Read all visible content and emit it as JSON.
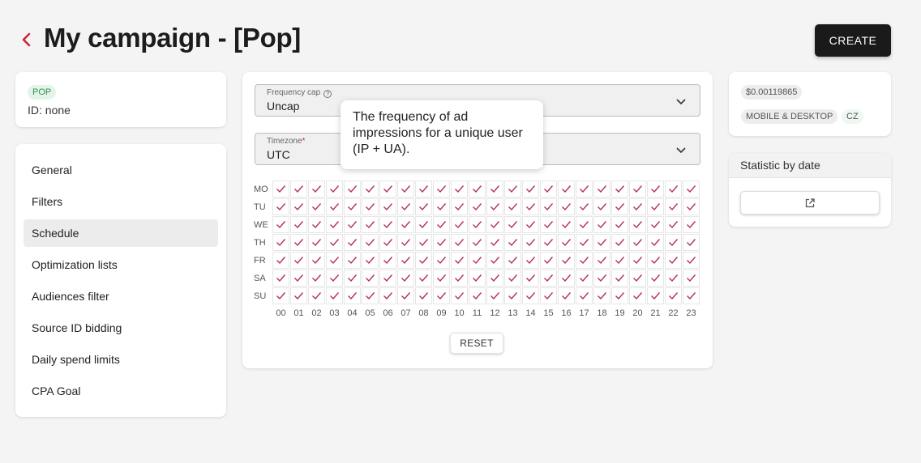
{
  "header": {
    "title": "My campaign - [Pop]",
    "create_label": "CREATE"
  },
  "campaign": {
    "type_badge": "POP",
    "id_text": "ID: none"
  },
  "nav": {
    "items": [
      {
        "label": "General",
        "active": false
      },
      {
        "label": "Filters",
        "active": false
      },
      {
        "label": "Schedule",
        "active": true
      },
      {
        "label": "Optimization lists",
        "active": false
      },
      {
        "label": "Audiences filter",
        "active": false
      },
      {
        "label": "Source ID bidding",
        "active": false
      },
      {
        "label": "Daily spend limits",
        "active": false
      },
      {
        "label": "CPA Goal",
        "active": false
      }
    ]
  },
  "schedule": {
    "frequency_cap": {
      "label": "Frequency cap",
      "value": "Uncap"
    },
    "timezone": {
      "label": "Timezone",
      "required_mark": "*",
      "value": "UTC"
    },
    "days": [
      "MO",
      "TU",
      "WE",
      "TH",
      "FR",
      "SA",
      "SU"
    ],
    "hours": [
      "00",
      "01",
      "02",
      "03",
      "04",
      "05",
      "06",
      "07",
      "08",
      "09",
      "10",
      "11",
      "12",
      "13",
      "14",
      "15",
      "16",
      "17",
      "18",
      "19",
      "20",
      "21",
      "22",
      "23"
    ],
    "all_selected": true,
    "reset_label": "RESET",
    "check_color": "#b5304f"
  },
  "tooltip": {
    "text": "The frequency of ad impressions for a unique user (IP + UA)."
  },
  "info": {
    "price": "$0.00119865",
    "device": "MOBILE & DESKTOP",
    "country": "CZ"
  },
  "stats": {
    "title": "Statistic by date",
    "open_icon": "external-link-icon"
  },
  "colors": {
    "accent_red": "#c62839",
    "dark_button": "#1a1a1a",
    "pop_badge_bg": "#e3f5e9"
  }
}
